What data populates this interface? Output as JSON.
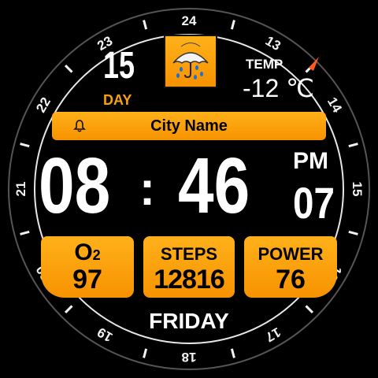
{
  "bezel": {
    "hour_numbers": [
      "24",
      "13",
      "14",
      "15",
      "16",
      "17",
      "18",
      "19",
      "20",
      "21",
      "22",
      "23"
    ]
  },
  "date": {
    "day_number": "15",
    "day_label": "DAY"
  },
  "weather": {
    "icon": "umbrella-rain-icon",
    "temp_label": "TEMP",
    "temp_value": "-12 ℃"
  },
  "location": {
    "city": "City Name",
    "alarm_icon": "bell-icon"
  },
  "time": {
    "hours": "08",
    "separator": ":",
    "minutes": "46",
    "ampm": "PM",
    "seconds": "07"
  },
  "stats": {
    "oxygen": {
      "label_main": "O",
      "label_sub": "2",
      "value": "97"
    },
    "steps": {
      "label": "STEPS",
      "value": "12816"
    },
    "power": {
      "label": "POWER",
      "value": "76"
    }
  },
  "weekday": "FRIDAY",
  "colors": {
    "accent": "#f8a10f",
    "background": "#000000",
    "indicator": "#ff5a1f"
  }
}
